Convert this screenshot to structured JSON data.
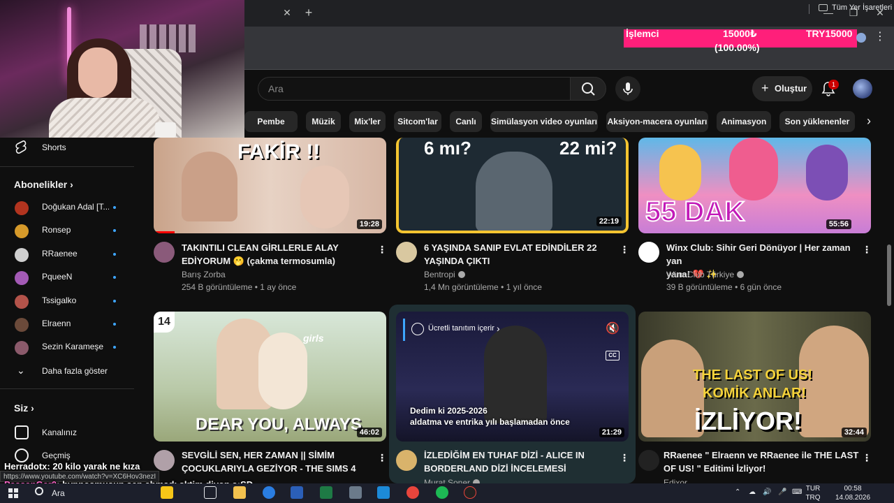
{
  "browser": {
    "bookmarks_folder": "Tüm Yer İşaretleri"
  },
  "price_widget": {
    "label": "İşlemci",
    "value": "15000₺",
    "currency_value": "TRY15000",
    "percent": "(100.00%)",
    "color": "#ff1f7a"
  },
  "header": {
    "search_placeholder": "Ara",
    "create_label": "Oluştur",
    "notifications_count": "1"
  },
  "chips": [
    "Pembe diziler",
    "Müzik",
    "Mix'ler",
    "Sitcom'lar",
    "Canlı",
    "Simülasyon video oyunları",
    "Aksiyon-macera oyunları",
    "Animasyon",
    "Son yüklenenler"
  ],
  "sidebar": {
    "shorts": "Shorts",
    "subscriptions_heading": "Abonelikler",
    "subscriptions": [
      {
        "name": "Doğukan Adal [T...",
        "color": "#b2341f"
      },
      {
        "name": "Ronsep",
        "color": "#d69a2a"
      },
      {
        "name": "RRaenee",
        "color": "#cfcfcf"
      },
      {
        "name": "PqueeN",
        "color": "#a35ab5"
      },
      {
        "name": "Tssigalko",
        "color": "#b3534a"
      },
      {
        "name": "Elraenn",
        "color": "#6b4a3a"
      },
      {
        "name": "Sezin Karameşe",
        "color": "#8b5a6b"
      }
    ],
    "show_more": "Daha fazla göster",
    "you_heading": "Siz",
    "your_channel": "Kanalınız",
    "history": "Geçmiş"
  },
  "videos": [
    {
      "title_line1": "TAKINTILI CLEAN GİRLLERLE ALAY",
      "title_line2": "EDİYORUM 🫢 (çakma termosumla)",
      "channel": "Barış Zorba",
      "views": "254 B görüntüleme",
      "age": "1 ay önce",
      "duration": "19:28",
      "thumb_text": "FAKİR !!"
    },
    {
      "title_line1": "6 YAŞINDA SANIP EVLAT EDİNDİLER 22",
      "title_line2": "YAŞINDA ÇIKTI",
      "channel": "Bentropi",
      "views": "1,4 Mn görüntüleme",
      "age": "1 yıl önce",
      "duration": "22:19",
      "thumb_text_left": "6 mı?",
      "thumb_text_right": "22 mi?"
    },
    {
      "title_line1": "Winx Club: Sihir Geri Dönüyor | Her zaman yan",
      "title_line2": "yana! 💔 ✨",
      "channel": "Winx Club Türkiye",
      "views": "39 B görüntüleme",
      "age": "6 gün önce",
      "duration": "55:56",
      "thumb_text": "55 DAK"
    },
    {
      "title_line1": "SEVGİLİ SEN, HER ZAMAN || SİMİM",
      "title_line2": "ÇOCUKLARIYLA GEZİYOR - THE SIMS 4",
      "duration": "46:02",
      "thumb_text": "DEAR YOU, ALWAYS",
      "badge": "14",
      "thumb_small": "girls"
    },
    {
      "title_line1": "İZLEDİĞİM EN TUHAF DİZİ - ALICE IN",
      "title_line2": "BORDERLAND DİZİ İNCELEMESİ",
      "channel": "Murat Soner",
      "duration": "21:29",
      "promo": "Ücretli tanıtım içerir",
      "caption_line1": "Dedim ki 2025-2026",
      "caption_line2": "aldatma ve entrika yılı başlamadan önce",
      "cc": "CC"
    },
    {
      "title_line1": "RRaenee \" Elraenn ve RRaenee ile THE LAST",
      "title_line2": "OF US! \" Editimi İzliyor!",
      "channel": "Edixor",
      "duration": "32:44",
      "thumb_text1": "THE LAST OF US!",
      "thumb_text2": "KOMİK ANLAR!",
      "thumb_text3": "İZLİYOR!"
    }
  ],
  "chat": {
    "user1": "Herradotx",
    "msg1": ": 20 kilo yarak ne kıza",
    "user2": "PassanGer0",
    "msg2": ": hypnosmusun sen ahmadı sktim diyon a:SD"
  },
  "status_url": "https://www.youtube.com/watch?v=XC6Hov3nezI",
  "taskbar": {
    "search": "Ara",
    "lang_line1": "TUR",
    "lang_line2": "TRQ",
    "time": "00:58",
    "date": "14.08.2026"
  }
}
